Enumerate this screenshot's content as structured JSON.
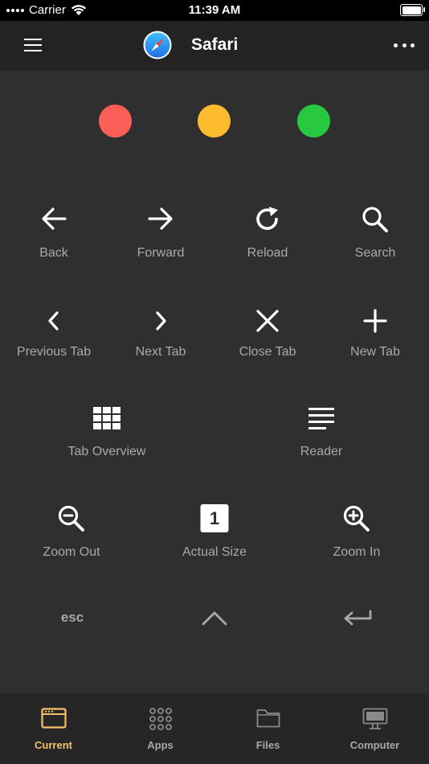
{
  "status_bar": {
    "carrier": "Carrier",
    "time": "11:39 AM",
    "battery_level": 1.0
  },
  "navbar": {
    "title": "Safari",
    "app_icon": "safari-compass-icon"
  },
  "traffic_lights": [
    {
      "name": "close",
      "color": "#fc5f57"
    },
    {
      "name": "minimize",
      "color": "#fdbb2e"
    },
    {
      "name": "zoom",
      "color": "#28c840"
    }
  ],
  "controls": {
    "back": "Back",
    "forward": "Forward",
    "reload": "Reload",
    "search": "Search",
    "previous_tab": "Previous Tab",
    "next_tab": "Next Tab",
    "close_tab": "Close Tab",
    "new_tab": "New Tab",
    "tab_overview": "Tab Overview",
    "reader": "Reader",
    "zoom_out": "Zoom Out",
    "actual_size": "Actual Size",
    "actual_size_badge": "1",
    "zoom_in": "Zoom In",
    "esc": "esc"
  },
  "tabbar": {
    "items": [
      {
        "label": "Current",
        "icon": "window-icon",
        "active": true
      },
      {
        "label": "Apps",
        "icon": "grid-icon",
        "active": false
      },
      {
        "label": "Files",
        "icon": "folder-icon",
        "active": false
      },
      {
        "label": "Computer",
        "icon": "monitor-icon",
        "active": false
      }
    ]
  },
  "colors": {
    "accent": "#f5c06a",
    "background": "#2f2f2f",
    "navbar": "#232323",
    "label": "#a9a9a9"
  }
}
